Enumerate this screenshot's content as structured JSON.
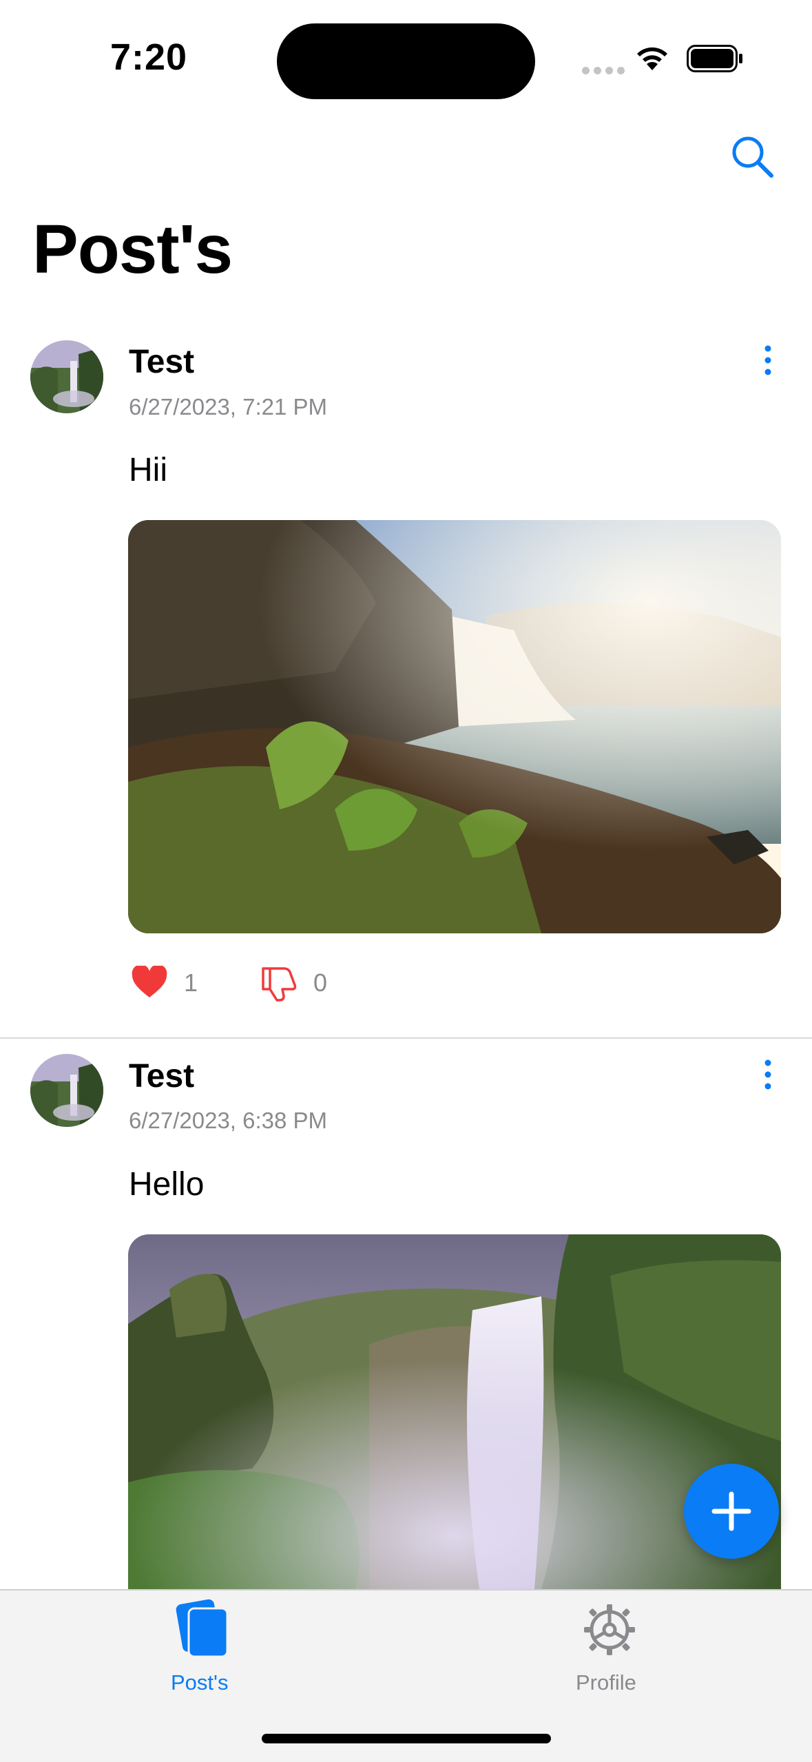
{
  "status_bar": {
    "time": "7:20"
  },
  "header": {
    "title": "Post's",
    "search_icon": "search-icon"
  },
  "posts": [
    {
      "author": "Test",
      "timestamp": "6/27/2023, 7:21 PM",
      "text": "Hii",
      "image": "waterfall-photo",
      "likes": "1",
      "dislikes": "0"
    },
    {
      "author": "Test",
      "timestamp": "6/27/2023, 6:38 PM",
      "text": "Hello",
      "image": "waterfall-photo"
    }
  ],
  "tabs": [
    {
      "label": "Post's",
      "icon": "cards-icon",
      "active": true
    },
    {
      "label": "Profile",
      "icon": "gear-icon",
      "active": false
    }
  ],
  "colors": {
    "accent": "#0a7cf5",
    "like": "#f03a3a",
    "dislike": "#f03a3a",
    "muted": "#8a8a8e"
  }
}
